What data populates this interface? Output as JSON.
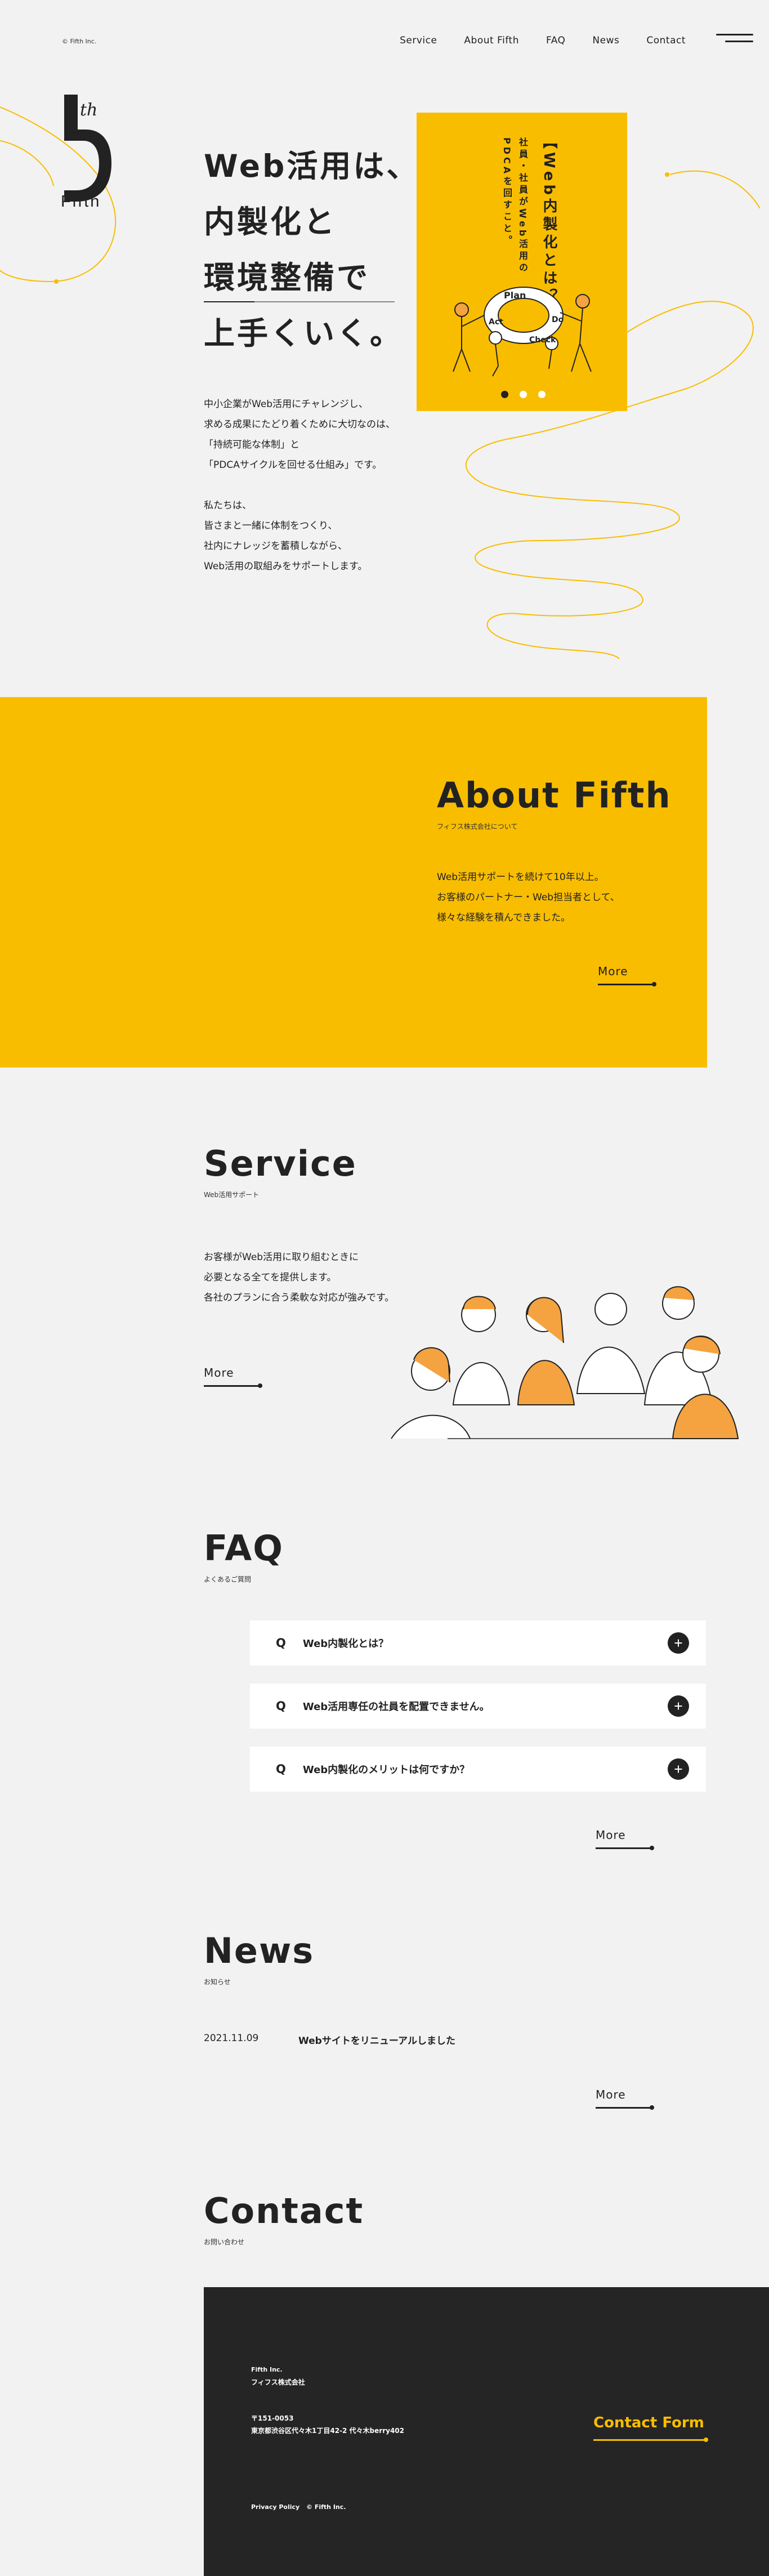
{
  "header": {
    "copyright": "© Fifth Inc.",
    "nav": [
      "Service",
      "About Fifth",
      "FAQ",
      "News",
      "Contact"
    ],
    "menu_icon": "hamburger-icon"
  },
  "logo": {
    "numeral": "5",
    "superscript": "th",
    "wordmark": "Fifth"
  },
  "hero": {
    "title_lines": [
      "Web活用は、",
      "内製化と",
      "環境整備で",
      "上手くいく。"
    ],
    "desc_p1": [
      "中小企業がWeb活用にチャレンジし、",
      "求める成果にたどり着くために大切なのは、",
      "「持続可能な体制」と",
      "「PDCAサイクルを回せる仕組み」です。"
    ],
    "desc_p2": [
      "私たちは、",
      "皆さまと一緒に体制をつくり、",
      "社内にナレッジを蓄積しながら、",
      "Web活用の取組みをサポートします。"
    ]
  },
  "card": {
    "title": "【Web内製化とは？】",
    "sub_lines": [
      "社員・社員がWeb活用の",
      "PDCAを回すこと。"
    ],
    "illust_words": [
      "Plan",
      "Do",
      "Check",
      "Act"
    ],
    "dots": 3,
    "active_dot": 0,
    "bg_color": "#f9bd00"
  },
  "about": {
    "heading": "About Fifth",
    "sub": "フィフス株式会社について",
    "desc": [
      "Web活用サポートを続けて10年以上。",
      "お客様のパートナー・Web担当者として、",
      "様々な経験を積んできました。"
    ],
    "more": "More"
  },
  "service": {
    "heading": "Service",
    "sub": "Web活用サポート",
    "desc": [
      "お客様がWeb活用に取り組むときに",
      "必要となる全てを提供します。",
      "各社のプランに合う柔軟な対応が強みです。"
    ],
    "more": "More"
  },
  "faq": {
    "heading": "FAQ",
    "sub": "よくあるご質問",
    "q_label": "Q",
    "items": [
      "Web内製化とは？",
      "Web活用専任の社員を配置できません。",
      "Web内製化のメリットは何ですか？"
    ],
    "more": "More"
  },
  "news": {
    "heading": "News",
    "sub": "お知らせ",
    "items": [
      {
        "date": "2021.11.09",
        "title": "Webサイトをリニューアルしました"
      }
    ],
    "more": "More"
  },
  "contact": {
    "heading": "Contact",
    "sub": "お問い合わせ",
    "company_en": "Fifth Inc.",
    "company_ja": "フィフス株式会社",
    "postal": "〒151-0053",
    "address": "東京都渋谷区代々木1丁目42-2 代々木berry402",
    "privacy": "Privacy Policy",
    "copyright": "© Fifth Inc.",
    "form_link": "Contact Form",
    "accent": "#f9bd00",
    "footer_bg": "#252525"
  }
}
